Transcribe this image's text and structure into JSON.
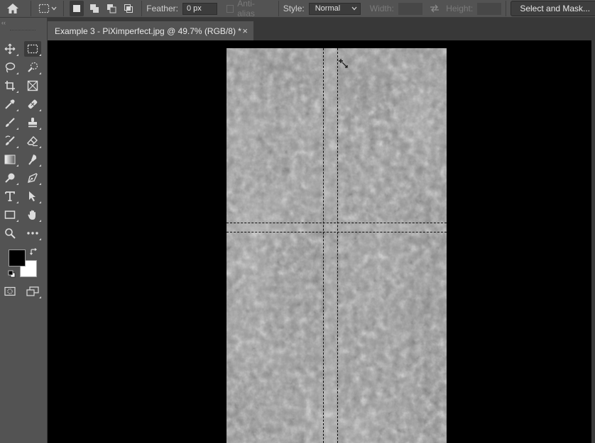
{
  "options_bar": {
    "feather_label": "Feather:",
    "feather_value": "0 px",
    "anti_alias_label": "Anti-alias",
    "style_label": "Style:",
    "style_value": "Normal",
    "width_label": "Width:",
    "height_label": "Height:",
    "select_mask_label": "Select and Mask..."
  },
  "document_tab": {
    "title": "Example 3 - PiXimperfect.jpg @ 49.7% (RGB/8) *",
    "close_glyph": "×"
  },
  "tools": [
    "move-tool-icon",
    "rectangular-marquee-tool-icon",
    "lasso-tool-icon",
    "quick-selection-tool-icon",
    "crop-tool-icon",
    "frame-tool-icon",
    "eyedropper-tool-icon",
    "healing-brush-tool-icon",
    "brush-tool-icon",
    "clone-stamp-tool-icon",
    "history-brush-tool-icon",
    "eraser-tool-icon",
    "gradient-tool-icon",
    "smudge-tool-icon",
    "dodge-tool-icon",
    "pen-tool-icon",
    "type-tool-icon",
    "path-selection-tool-icon",
    "rectangle-tool-icon",
    "hand-tool-icon",
    "zoom-tool-icon",
    "more-tools-icon",
    "quick-mask-icon",
    "screen-mode-icon"
  ],
  "colors": {
    "foreground": "#000000",
    "background": "#ffffff",
    "panel": "#535353",
    "canvas_bg": "#000000"
  }
}
